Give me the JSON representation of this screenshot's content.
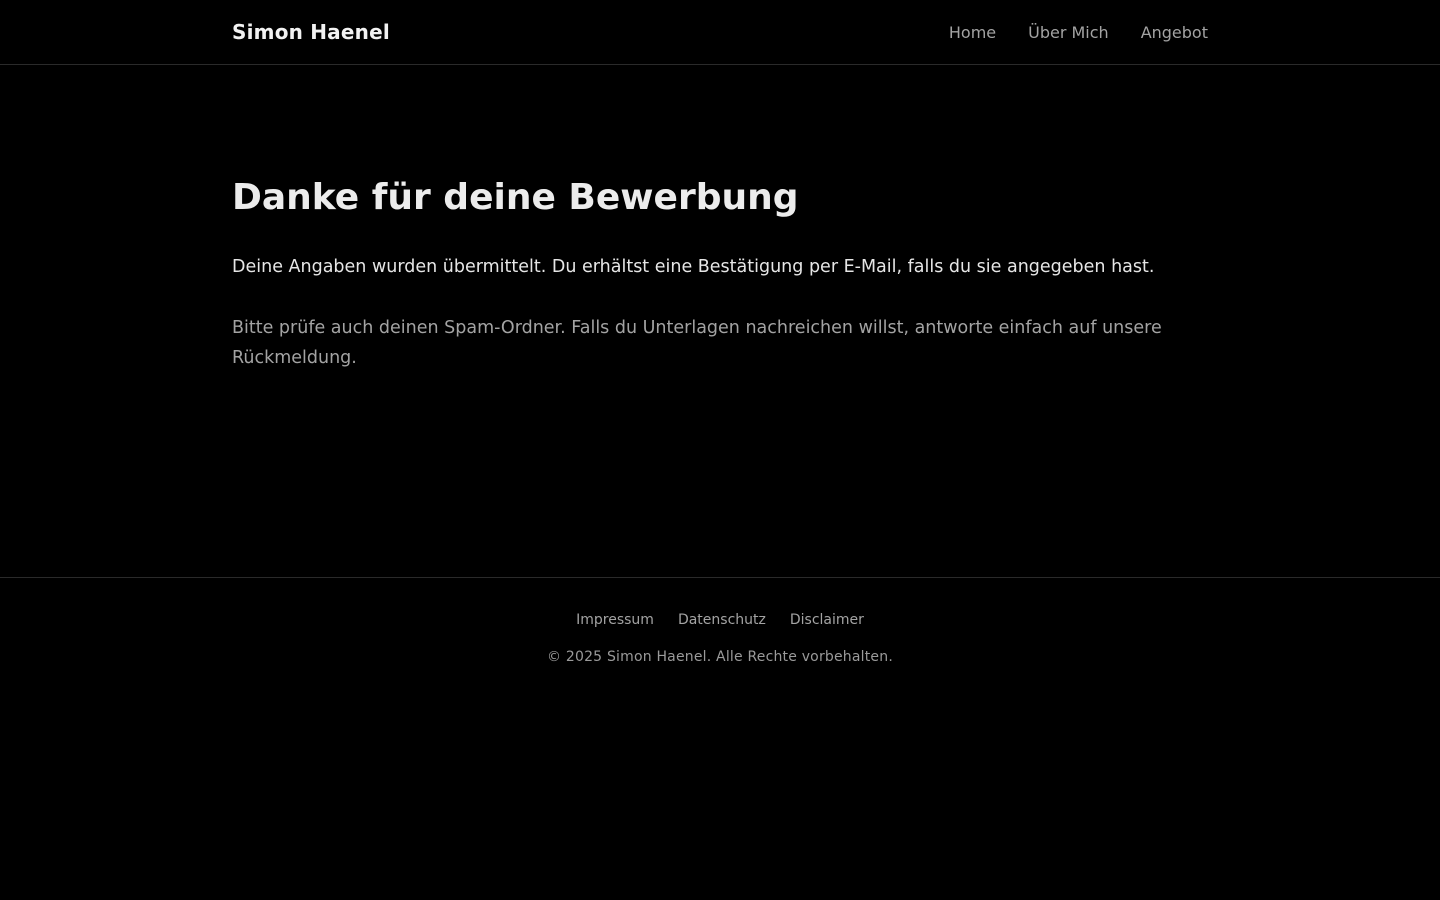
{
  "header": {
    "brand": "Simon Haenel",
    "nav": [
      {
        "label": "Home"
      },
      {
        "label": "Über Mich"
      },
      {
        "label": "Angebot"
      }
    ]
  },
  "main": {
    "title": "Danke für deine Bewerbung",
    "lead": "Deine Angaben wurden übermittelt. Du erhältst eine Bestätigung per E-Mail, falls du sie angegeben hast.",
    "note": "Bitte prüfe auch deinen Spam-Ordner. Falls du Unterlagen nachreichen willst, antworte einfach auf unsere Rückmeldung."
  },
  "footer": {
    "links": [
      {
        "label": "Impressum"
      },
      {
        "label": "Datenschutz"
      },
      {
        "label": "Disclaimer"
      }
    ],
    "copyright": "© 2025 Simon Haenel. Alle Rechte vorbehalten."
  },
  "colors": {
    "background": "#000000",
    "text_primary": "#ececec",
    "text_muted": "#a3a3a3",
    "divider": "#2a2a2a"
  }
}
